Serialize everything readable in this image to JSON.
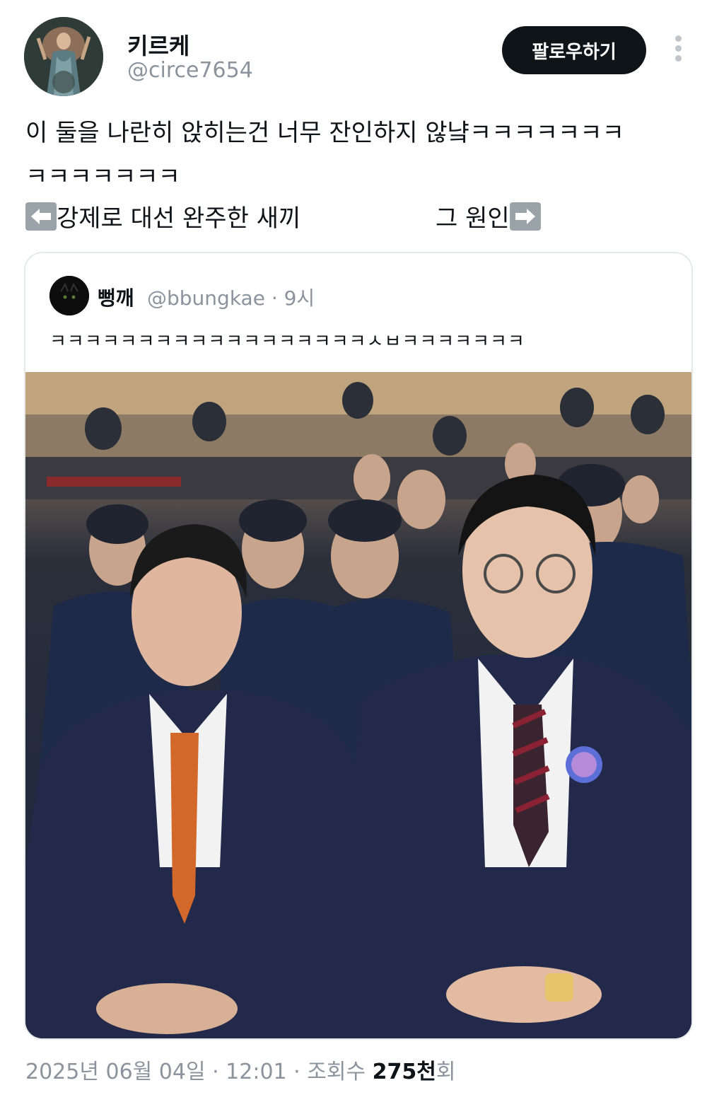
{
  "author": {
    "display_name": "키르케",
    "handle": "@circe7654",
    "avatar_icon": "profile-avatar"
  },
  "follow_button": {
    "label": "팔로우하기"
  },
  "more_menu": {
    "icon": "more-vertical-icon"
  },
  "tweet": {
    "line1": "이 둘을 나란히 앉히는건 너무 잔인하지 않냨ㅋㅋㅋㅋㅋㅋㅋ",
    "line2": "ㅋㅋㅋㅋㅋㅋㅋ",
    "left_caption": "강제로 대선 완주한 새끼",
    "right_caption": "그 원인",
    "left_arrow_icon": "left-arrow-icon",
    "right_arrow_icon": "right-arrow-icon"
  },
  "quoted_tweet": {
    "display_name": "뻥깨",
    "handle_time": "@bbungkae · 9시",
    "text": "ㅋㅋㅋㅋㅋㅋㅋㅋㅋㅋㅋㅋㅋㅋㅋㅋㅋㅋㅅㅂㅋㅋㅋㅋㅋㅋㅋ",
    "photo": "event-photo"
  },
  "meta": {
    "timestamp_prefix": "2025년 06월 04일 · 12:01 · 조회수 ",
    "views_bold": "275천",
    "views_suffix": "회"
  },
  "colors": {
    "follow_bg": "#0f1419",
    "secondary_text": "#8b949c",
    "card_border": "#e6e9ea"
  }
}
